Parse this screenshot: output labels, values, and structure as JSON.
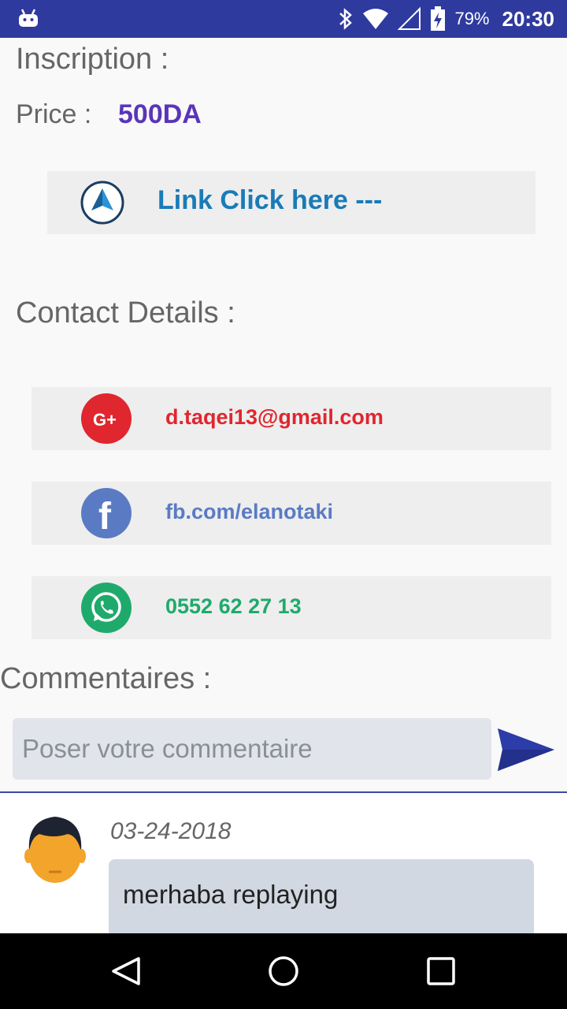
{
  "status_bar": {
    "battery_percent": "79%",
    "time": "20:30"
  },
  "inscription": {
    "label": "Inscription :"
  },
  "price": {
    "label": "Price :",
    "value": "500DA"
  },
  "link_button": {
    "label": "Link Click here ---"
  },
  "contact": {
    "heading": "Contact Details :",
    "items": [
      {
        "icon": "google-plus-icon",
        "text": "d.taqei13@gmail.com",
        "color": "#e0262e"
      },
      {
        "icon": "facebook-icon",
        "text": "fb.com/elanotaki",
        "color": "#5a7bc4"
      },
      {
        "icon": "whatsapp-icon",
        "text": "0552 62 27 13",
        "color": "#1faa6c"
      }
    ]
  },
  "comments": {
    "heading": "Commentaires :",
    "input_placeholder": "Poser votre commentaire",
    "list": [
      {
        "date": "03-24-2018",
        "text": "merhaba replaying"
      }
    ]
  },
  "colors": {
    "status_bar": "#2f3a9e",
    "price": "#5a35b8",
    "link": "#1a7bb8",
    "send_arrow": "#2c3ca8"
  }
}
